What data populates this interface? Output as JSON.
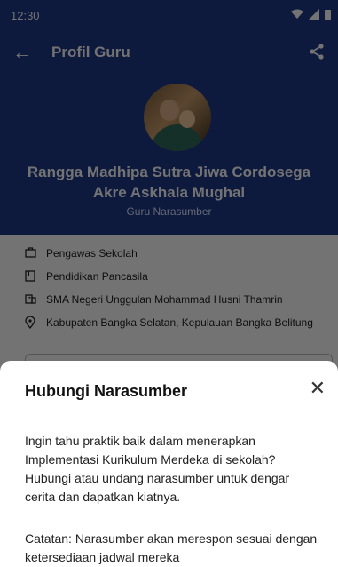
{
  "statusbar": {
    "time": "12:30"
  },
  "appbar": {
    "title": "Profil Guru"
  },
  "profile": {
    "name": "Rangga Madhipa Sutra Jiwa Cordosega Akre Askhala Mughal",
    "role": "Guru Narasumber"
  },
  "details": [
    {
      "icon": "briefcase-icon",
      "text": "Pengawas Sekolah"
    },
    {
      "icon": "book-icon",
      "text": "Pendidikan Pancasila"
    },
    {
      "icon": "school-icon",
      "text": "SMA Negeri Unggulan Mohammad Husni Thamrin"
    },
    {
      "icon": "location-pin-icon",
      "text": "Kabupaten Bangka Selatan, Kepulauan Bangka Belitung"
    }
  ],
  "sheet": {
    "title": "Hubungi Narasumber",
    "description": "Ingin tahu praktik baik dalam menerapkan Implementasi Kurikulum Merdeka di sekolah? Hubungi atau undang narasumber untuk dengar cerita dan dapatkan kiatnya.",
    "note": "Catatan: Narasumber akan merespon sesuai dengan ketersediaan jadwal mereka"
  },
  "colors": {
    "header": "#1e3a8a",
    "scrim": "rgba(0,0,0,0.55)"
  }
}
